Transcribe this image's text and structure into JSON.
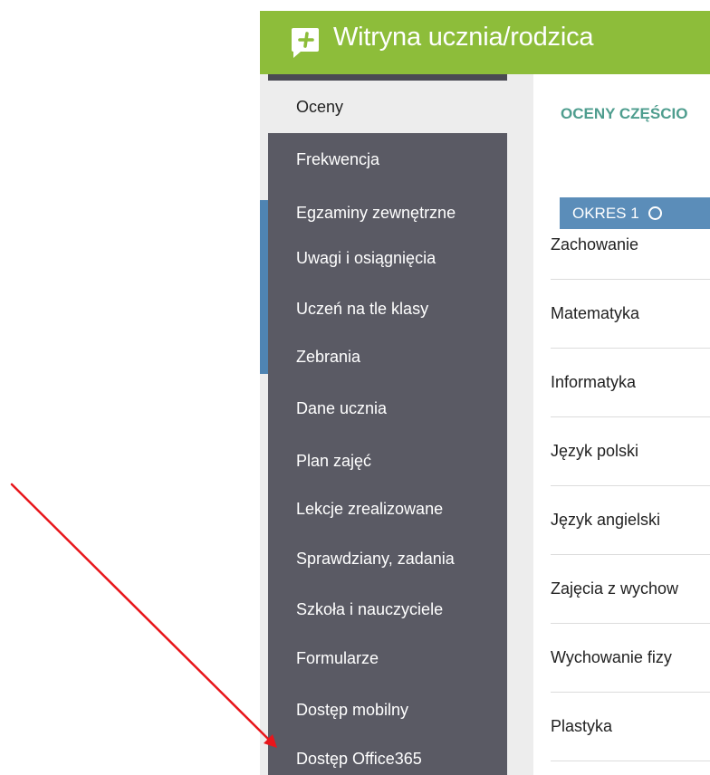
{
  "app": {
    "title": "Witryna ucznia/rodzica",
    "header_color": "#8dbd3a"
  },
  "sidebar": {
    "items": [
      {
        "label": "Oceny",
        "active": true
      },
      {
        "label": "Frekwencja"
      },
      {
        "label": "Egzaminy zewnętrzne"
      },
      {
        "label": "Uwagi i osiągnięcia"
      },
      {
        "label": "Uczeń na tle klasy"
      },
      {
        "label": "Zebrania"
      },
      {
        "label": "Dane ucznia"
      },
      {
        "label": "Plan zajęć"
      },
      {
        "label": "Lekcje zrealizowane"
      },
      {
        "label": "Sprawdziany, zadania"
      },
      {
        "label": "Szkoła i nauczyciele"
      },
      {
        "label": "Formularze"
      },
      {
        "label": "Dostęp mobilny"
      },
      {
        "label": "Dostęp Office365"
      }
    ]
  },
  "main": {
    "section_title": "OCENY CZĘŚCIO",
    "period_tab": "OKRES 1",
    "subjects": [
      "Zachowanie",
      "Matematyka",
      "Informatyka",
      "Język polski",
      "Język angielski",
      "Zajęcia z wychow",
      "Wychowanie fizy",
      "Plastyka"
    ]
  },
  "icons": {
    "logo": "chat-plus-icon",
    "period": "circle-icon"
  },
  "colors": {
    "sidebar_bg": "#5a5a64",
    "active_item_bg": "#ededed",
    "section_title": "#4e9d8e",
    "period_tab": "#5b8db9",
    "annotation_arrow": "#e8161b"
  }
}
